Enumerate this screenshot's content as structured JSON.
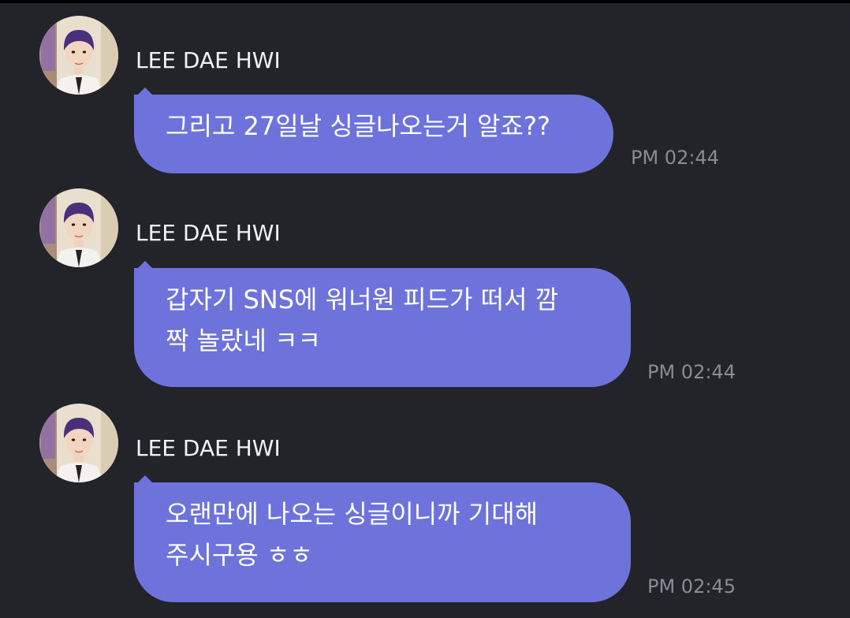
{
  "colors": {
    "background": "#23232a",
    "bubble": "#6e73dc",
    "bubble_text": "#ffffff",
    "sender_text": "#f2f2f5",
    "timestamp": "#8b8b93"
  },
  "messages": [
    {
      "sender": "LEE DAE HWI",
      "text": "그리고 27일날 싱글나오는거 알죠??",
      "time": "PM 02:44"
    },
    {
      "sender": "LEE DAE HWI",
      "text": "갑자기 SNS에 워너원 피드가 떠서 깜\n짝 놀랐네 ㅋㅋ",
      "time": "PM 02:44"
    },
    {
      "sender": "LEE DAE HWI",
      "text": "오랜만에 나오는 싱글이니까 기대해\n주시구용 ㅎㅎ",
      "time": "PM 02:45"
    }
  ]
}
